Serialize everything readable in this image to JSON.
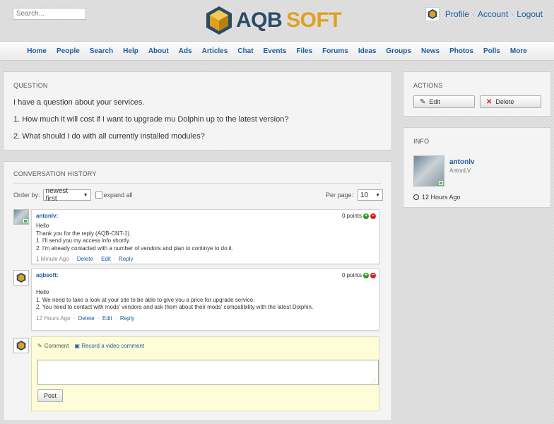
{
  "header": {
    "search_placeholder": "Search...",
    "logo": {
      "part1": "AQB",
      "part2": "SOFT"
    },
    "user_links": [
      "Profile",
      "Account",
      "Logout"
    ],
    "link_separator": "·"
  },
  "nav": {
    "items": [
      "Home",
      "People",
      "Search",
      "Help",
      "About",
      "Ads",
      "Articles",
      "Chat",
      "Events",
      "Files",
      "Forums",
      "Ideas",
      "Groups",
      "News",
      "Photos",
      "Polls",
      "More"
    ]
  },
  "question": {
    "title": "QUESTION",
    "lines": [
      "I have a question about your services.",
      "1. How much it will cost if I want to upgrade mu Dolphin up to the latest version?",
      "2. What should I do with all currently installed modules?"
    ]
  },
  "history": {
    "title": "CONVERSATION HISTORY",
    "order_label": "Order by:",
    "order_value": "newest first",
    "expand_label": "expand all",
    "per_page_label": "Per page:",
    "per_page_value": "10",
    "comments": [
      {
        "author": "antonlv:",
        "points": "0 points",
        "lines": [
          "Hello",
          "Thank you for the reply (AQB-CNT-1).",
          "1. I'll send you my access info shortly.",
          "2. I'm already contacted with a number of vendors and plan to continye to do it."
        ],
        "time": "1 Minute Ago",
        "delete": "Delete",
        "edit": "Edit",
        "reply": "Reply"
      },
      {
        "author": "aqbsoft:",
        "points": "0 points",
        "lines": [
          "Hello",
          "1. We need to take a look at your site to be able to give you a price for upgrade service.",
          "2. You need to contact with mods' vendors and ask them about their mods' compatibility with the latest Dolphin."
        ],
        "time": "12 Hours Ago",
        "delete": "Delete",
        "edit": "Edit",
        "reply": "Reply"
      }
    ],
    "reply": {
      "comment_label": "Comment",
      "video_label": "Record a video comment",
      "post_label": "Post"
    }
  },
  "actions": {
    "title": "ACTIONS",
    "edit": "Edit",
    "delete": "Delete"
  },
  "info": {
    "title": "INFO",
    "name": "antonlv",
    "username": "AntonLV",
    "time": "12 Hours Ago"
  },
  "colors": {
    "link": "#1a5ea3",
    "brand_dark": "#2b4a66",
    "brand_gold": "#e0a11e",
    "reply_bg": "#fffcd8"
  }
}
